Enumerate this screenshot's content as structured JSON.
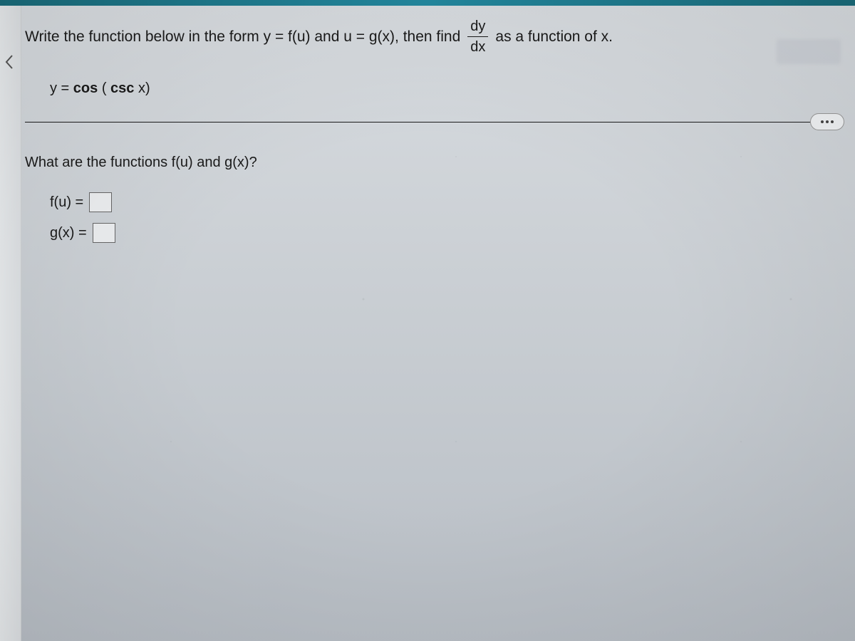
{
  "question": {
    "prefix": "Write the function below in the form y = f(u) and u = g(x), then find",
    "frac_num": "dy",
    "frac_den": "dx",
    "suffix": "as a function of x."
  },
  "given_equation": "y = cos ( csc x)",
  "sub_question": "What are the functions f(u) and g(x)?",
  "answers": {
    "fu_label": "f(u) =",
    "fu_value": "",
    "gx_label": "g(x) =",
    "gx_value": ""
  },
  "nav_arrow_glyph": "‹"
}
